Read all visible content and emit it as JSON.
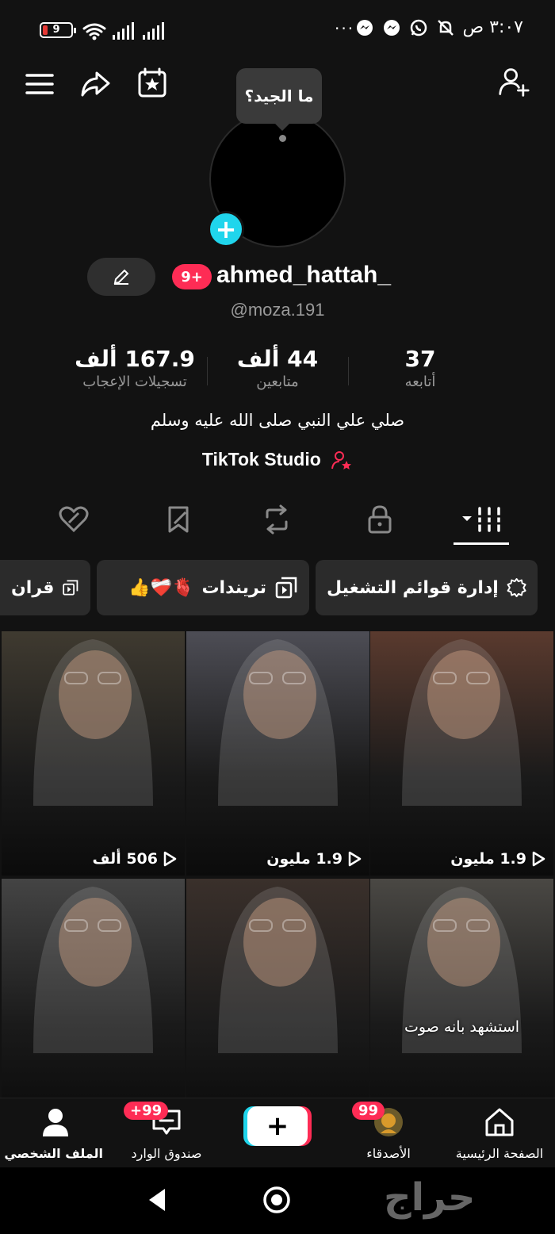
{
  "status_bar": {
    "time": "٣:٠٧ ص",
    "battery": "9",
    "more": "···"
  },
  "tooltip": {
    "text": "ما الجيد؟"
  },
  "profile": {
    "badge": "9+",
    "username": "ahmed_hattah_",
    "handle": "@moza.191",
    "bio": "صلي علي النبي صلى الله عليه وسلم",
    "studio": "TikTok Studio"
  },
  "stats": [
    {
      "value": "37",
      "label": "أتابعه"
    },
    {
      "value": "44 ألف",
      "label": "متابعين"
    },
    {
      "value": "167.9 ألف",
      "label": "تسجيلات الإعجاب"
    }
  ],
  "chips": [
    {
      "label": "إدارة قوائم التشغيل"
    },
    {
      "label": "تريندات",
      "emoji": "🫀❤️‍🩹👍"
    },
    {
      "label": "قران"
    }
  ],
  "videos": [
    {
      "views": "1.9 مليون",
      "caption": "",
      "tone": "#5a3a2e"
    },
    {
      "views": "1.9 مليون",
      "caption": "",
      "tone": "#4d4d55"
    },
    {
      "views": "506 ألف",
      "caption": "",
      "tone": "#3f3a30"
    },
    {
      "views": "",
      "caption": "استشهد بانه صوت",
      "tone": "#4a4844"
    },
    {
      "views": "",
      "caption": "",
      "tone": "#3a302b"
    },
    {
      "views": "",
      "caption": "",
      "tone": "#444444"
    }
  ],
  "bottom_nav": {
    "home": "الصفحة الرئيسية",
    "friends": "الأصدقاء",
    "friends_badge": "99",
    "inbox": "صندوق الوارد",
    "inbox_badge": "99+",
    "profile": "الملف الشخصي"
  },
  "watermark": "حراج"
}
